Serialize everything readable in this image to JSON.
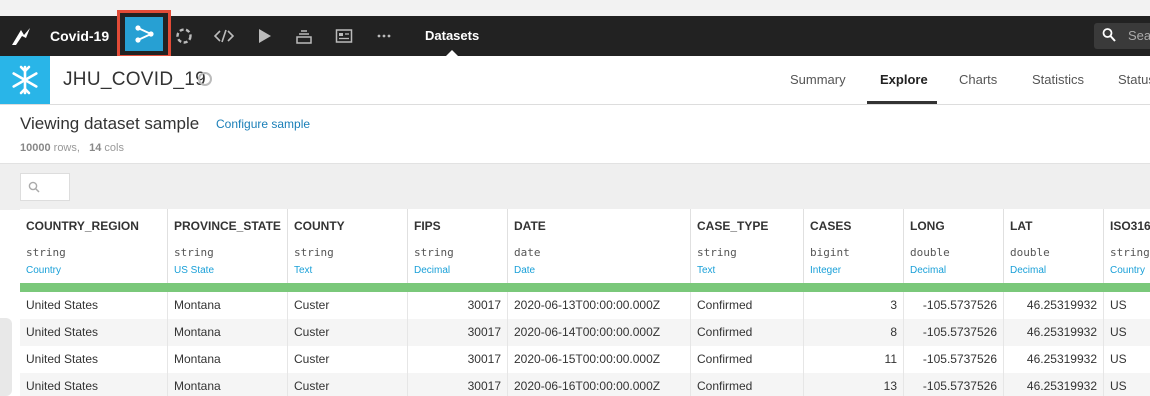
{
  "topbar": {
    "project_name": "Covid-19",
    "section_label": "Datasets",
    "search_placeholder": "Sea"
  },
  "dataset": {
    "name": "JHU_COVID_19",
    "tabs": [
      "Summary",
      "Explore",
      "Charts",
      "Statistics",
      "Status"
    ],
    "active_tab": "Explore"
  },
  "sample": {
    "title": "Viewing dataset sample",
    "configure_label": "Configure sample",
    "rows_count": "10000",
    "rows_label": "rows,",
    "cols_count": "14",
    "cols_label": "cols"
  },
  "table": {
    "columns": [
      {
        "name": "COUNTRY_REGION",
        "type": "string",
        "meaning": "Country"
      },
      {
        "name": "PROVINCE_STATE",
        "type": "string",
        "meaning": "US State"
      },
      {
        "name": "COUNTY",
        "type": "string",
        "meaning": "Text"
      },
      {
        "name": "FIPS",
        "type": "string",
        "meaning": "Decimal"
      },
      {
        "name": "DATE",
        "type": "date",
        "meaning": "Date"
      },
      {
        "name": "CASE_TYPE",
        "type": "string",
        "meaning": "Text"
      },
      {
        "name": "CASES",
        "type": "bigint",
        "meaning": "Integer"
      },
      {
        "name": "LONG",
        "type": "double",
        "meaning": "Decimal"
      },
      {
        "name": "LAT",
        "type": "double",
        "meaning": "Decimal"
      },
      {
        "name": "ISO316",
        "type": "string",
        "meaning": "Country"
      }
    ],
    "rows": [
      [
        "United States",
        "Montana",
        "Custer",
        "30017",
        "2020-06-13T00:00:00.000Z",
        "Confirmed",
        "3",
        "-105.5737526",
        "46.25319932",
        "US"
      ],
      [
        "United States",
        "Montana",
        "Custer",
        "30017",
        "2020-06-14T00:00:00.000Z",
        "Confirmed",
        "8",
        "-105.5737526",
        "46.25319932",
        "US"
      ],
      [
        "United States",
        "Montana",
        "Custer",
        "30017",
        "2020-06-15T00:00:00.000Z",
        "Confirmed",
        "11",
        "-105.5737526",
        "46.25319932",
        "US"
      ],
      [
        "United States",
        "Montana",
        "Custer",
        "30017",
        "2020-06-16T00:00:00.000Z",
        "Confirmed",
        "13",
        "-105.5737526",
        "46.25319932",
        "US"
      ]
    ]
  },
  "colors": {
    "topbar_bg": "#222222",
    "flow_accent": "#27a0d3",
    "highlight_border": "#e24b37",
    "snowflake_bg": "#29b5e8",
    "link": "#1a7fb8",
    "quality_bar": "#7ac87a"
  },
  "icons": [
    "app-logo-icon",
    "flow-icon",
    "lab-icon",
    "code-icon",
    "run-icon",
    "jobs-icon",
    "dashboard-icon",
    "more-icon",
    "search-icon",
    "snowflake-icon",
    "dataset-status-icon"
  ]
}
